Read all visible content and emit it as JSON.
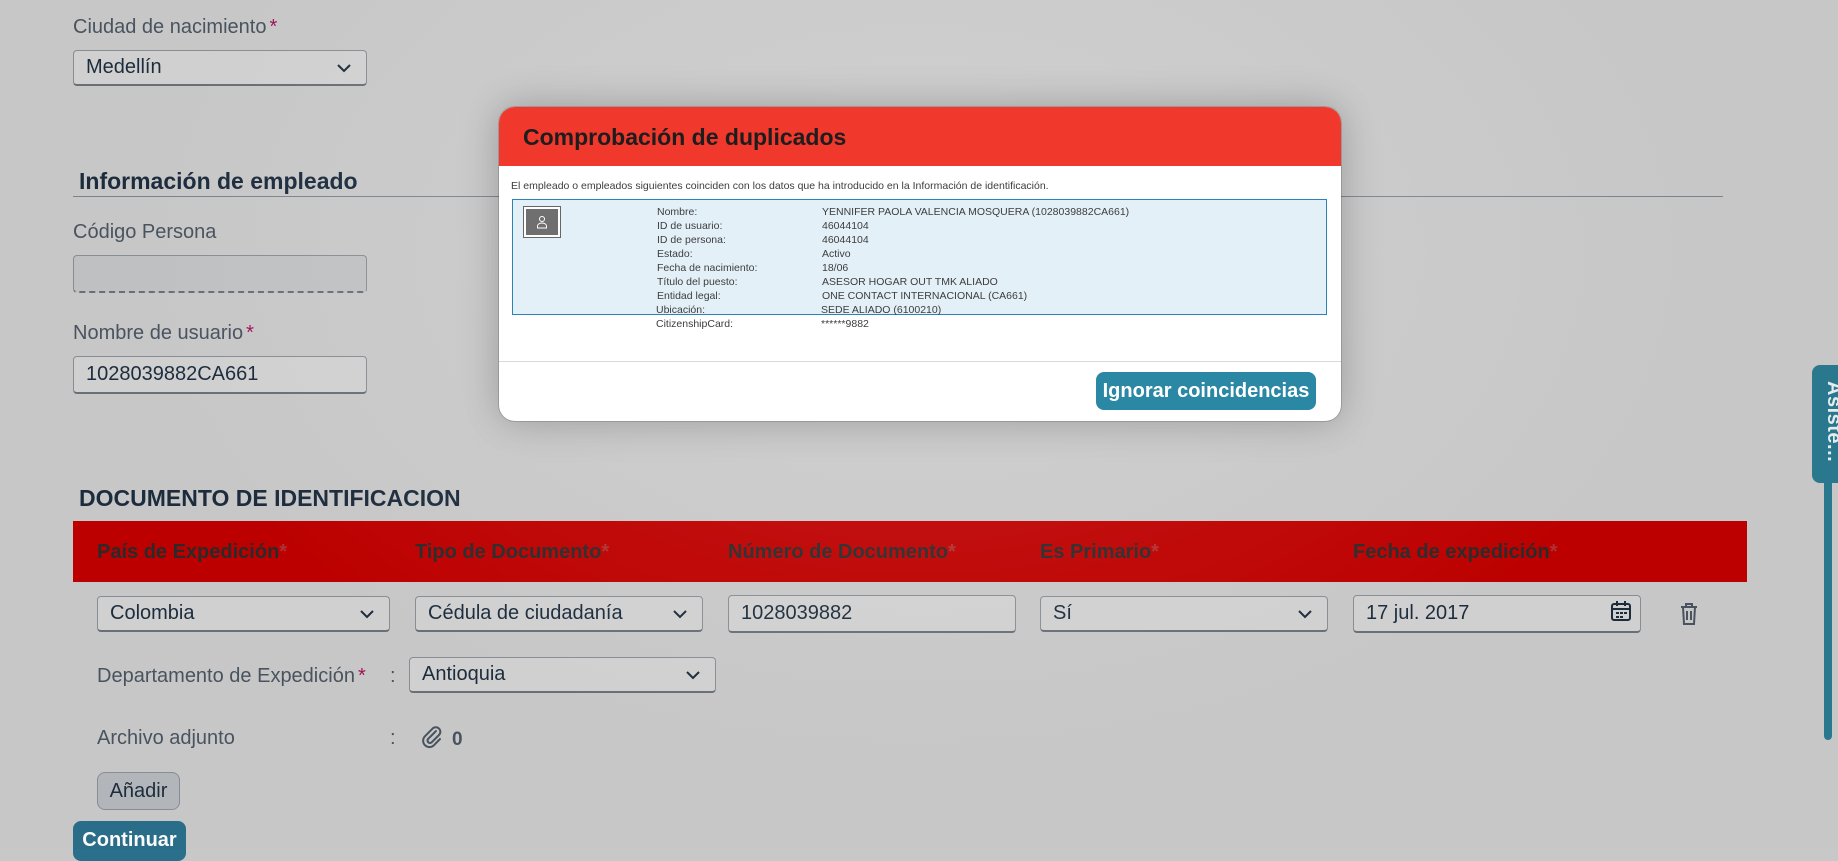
{
  "form": {
    "ciudad_label": "Ciudad de nacimiento",
    "ciudad_value": "Medellín",
    "section_empleado": "Información de empleado",
    "codigo_label": "Código Persona",
    "codigo_value": "",
    "usuario_label": "Nombre de usuario",
    "usuario_value": "1028039882CA661",
    "required_mark": "*"
  },
  "documento": {
    "section_title": "DOCUMENTO DE IDENTIFICACION",
    "columns": [
      "País de Expedición",
      "Tipo de Documento",
      "Número de Documento",
      "Es Primario",
      "Fecha de expedición"
    ],
    "pais": "Colombia",
    "tipo": "Cédula de ciudadanía",
    "numero": "1028039882",
    "primario": "Sí",
    "fecha": "17 jul. 2017",
    "depto_label": "Departamento de Expedición",
    "depto_value": "Antioquia",
    "archivo_label": "Archivo adjunto",
    "archivo_count": "0",
    "colon": ":",
    "add_button": "Añadir",
    "continue_button": "Continuar"
  },
  "side_tab": {
    "label": "Asiste..."
  },
  "dialog": {
    "title": "Comprobación de duplicados",
    "description": "El empleado o empleados siguientes coinciden con los datos que ha introducido en la Información de identificación.",
    "fields": [
      {
        "key": "Nombre:",
        "value": "YENNIFER PAOLA VALENCIA MOSQUERA (1028039882CA661)"
      },
      {
        "key": "ID de usuario:",
        "value": "46044104"
      },
      {
        "key": "ID de persona:",
        "value": "46044104"
      },
      {
        "key": "Estado:",
        "value": "Activo"
      },
      {
        "key": "Fecha de nacimiento:",
        "value": "18/06"
      },
      {
        "key": "Título del puesto:",
        "value": "ASESOR HOGAR OUT TMK ALIADO"
      },
      {
        "key": "Entidad legal:",
        "value": "ONE CONTACT INTERNACIONAL (CA661)"
      },
      {
        "key": "Ubicación:",
        "value": "SEDE ALIADO (6100210)"
      },
      {
        "key": "CitizenshipCard:",
        "value": "******9882"
      }
    ],
    "ignore_button": "Ignorar coincidencias"
  },
  "colors": {
    "table_header": "#c00000",
    "dialog_header": "#f0382c",
    "primary_button": "#2b88a5",
    "required": "#a1135a"
  }
}
